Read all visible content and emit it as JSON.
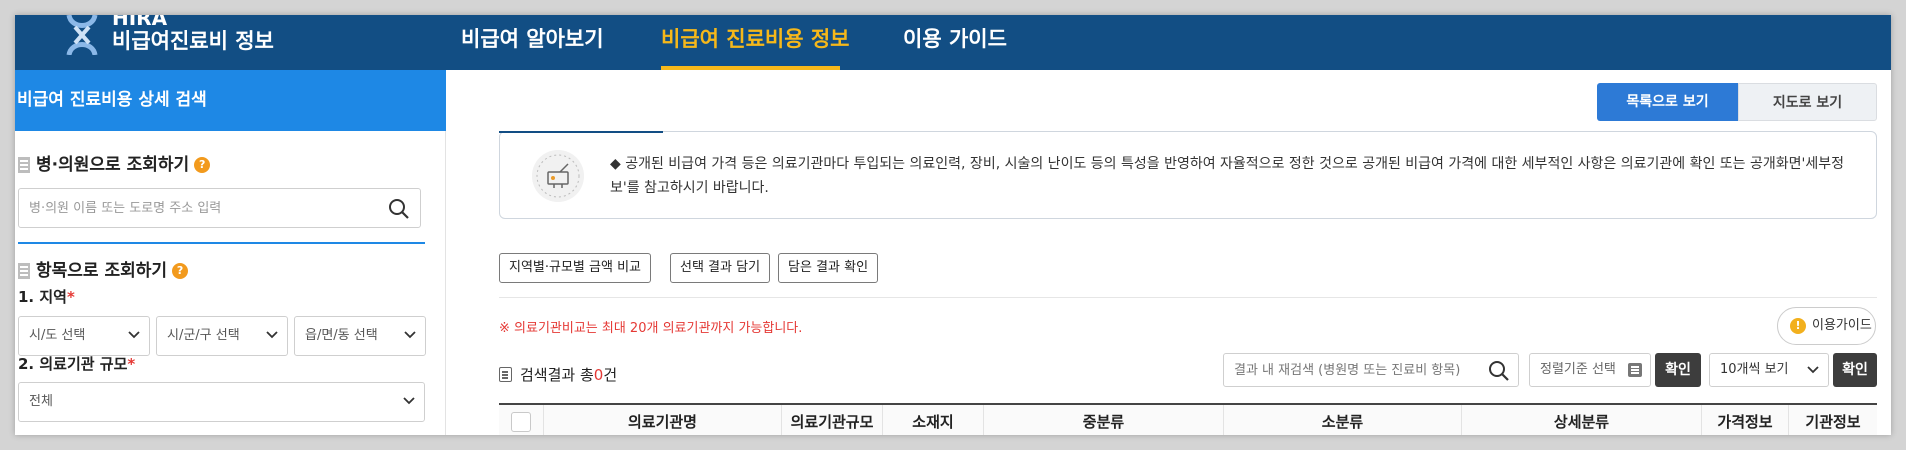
{
  "header": {
    "logo_text": "HIRA",
    "logo_sub": "비급여진료비 정보",
    "nav": [
      {
        "label": "비급여 알아보기"
      },
      {
        "label": "비급여 진료비용 정보"
      },
      {
        "label": "이용 가이드"
      }
    ]
  },
  "sidebar": {
    "title": "비급여 진료비용 상세 검색",
    "hospital": {
      "title": "병·의원으로 조회하기",
      "placeholder": "병·의원 이름 또는 도로명 주소 입력"
    },
    "item": {
      "title": "항목으로 조회하기"
    },
    "region": {
      "label": "1. 지역",
      "sido": "시/도 선택",
      "sigungu": "시/군/구 선택",
      "dong": "읍/면/동 선택"
    },
    "scale": {
      "label": "2. 의료기관 규모",
      "value": "전체"
    },
    "required_mark": "*",
    "help_mark": "?"
  },
  "main": {
    "view_list": "목록으로 보기",
    "view_map": "지도로 보기",
    "notice": "◆ 공개된 비급여 가격 등은 의료기관마다 투입되는 의료인력, 장비, 시술의 난이도 등의 특성을 반영하여 자율적으로 정한 것으로 공개된 비급여 가격에 대한 세부적인 사항은 의료기관에 확인 또는 공개화면'세부정보'를 참고하시기 바랍니다.",
    "buttons": {
      "compare": "지역별·규모별 금액 비교",
      "save": "선택 결과 담기",
      "check": "담은 결과 확인"
    },
    "warning": "※ 의료기관비교는 최대 20개 의료기관까지 가능합니다.",
    "guide": "이용가이드",
    "guide_mark": "!",
    "result_prefix": "검색결과 총",
    "result_count": "0",
    "result_suffix": "건",
    "result_search_placeholder": "결과 내 재검색 (병원명 또는 진료비 항목)",
    "sort_label": "정렬기준 선택",
    "confirm": "확인",
    "per_page": "10개씩 보기",
    "columns": [
      "의료기관명",
      "의료기관규모",
      "소재지",
      "중분류",
      "소분류",
      "상세분류",
      "가격정보",
      "기관정보"
    ]
  },
  "colors": {
    "nav_bg": "#124e84",
    "accent_yellow": "#f6b81a",
    "sidebar_head": "#1e88e5",
    "primary_button": "#2d7ad6",
    "warning_red": "#e53935"
  }
}
